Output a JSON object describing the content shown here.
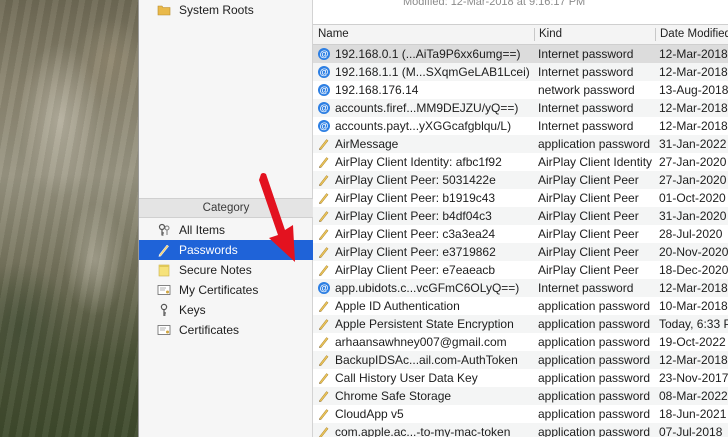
{
  "sidebar": {
    "system_roots": "System Roots",
    "category_header": "Category",
    "categories": [
      {
        "label": "All Items",
        "icon": "keys-icon"
      },
      {
        "label": "Passwords",
        "icon": "pen-icon"
      },
      {
        "label": "Secure Notes",
        "icon": "note-icon"
      },
      {
        "label": "My Certificates",
        "icon": "certificate-icon"
      },
      {
        "label": "Keys",
        "icon": "key-icon"
      },
      {
        "label": "Certificates",
        "icon": "certificate-icon"
      }
    ],
    "selected": "Passwords"
  },
  "main": {
    "modified_text": "Modified:  12-Mar-2018 at 9:16:17 PM",
    "columns": {
      "name": "Name",
      "kind": "Kind",
      "date": "Date Modified"
    },
    "rows": [
      {
        "name": "192.168.0.1 (...AiTa9P6xx6umg==)",
        "kind": "Internet password",
        "date": "12-Mar-2018",
        "icon": "globe"
      },
      {
        "name": "192.168.1.1 (M...SXqmGeLAB1Lcei)",
        "kind": "Internet password",
        "date": "12-Mar-2018",
        "icon": "globe"
      },
      {
        "name": "192.168.176.14",
        "kind": "network password",
        "date": "13-Aug-2018",
        "icon": "globe"
      },
      {
        "name": "accounts.firef...MM9DEJZU/yQ==)",
        "kind": "Internet password",
        "date": "12-Mar-2018",
        "icon": "globe"
      },
      {
        "name": "accounts.payt...yXGGcafgblqu/L)",
        "kind": "Internet password",
        "date": "12-Mar-2018",
        "icon": "globe"
      },
      {
        "name": "AirMessage",
        "kind": "application password",
        "date": "31-Jan-2022",
        "icon": "pen"
      },
      {
        "name": "AirPlay Client Identity: afbc1f92",
        "kind": "AirPlay Client Identity",
        "date": "27-Jan-2020",
        "icon": "pen"
      },
      {
        "name": "AirPlay Client Peer: 5031422e",
        "kind": "AirPlay Client Peer",
        "date": "27-Jan-2020",
        "icon": "pen"
      },
      {
        "name": "AirPlay Client Peer: b1919c43",
        "kind": "AirPlay Client Peer",
        "date": "01-Oct-2020",
        "icon": "pen"
      },
      {
        "name": "AirPlay Client Peer: b4df04c3",
        "kind": "AirPlay Client Peer",
        "date": "31-Jan-2020",
        "icon": "pen"
      },
      {
        "name": "AirPlay Client Peer: c3a3ea24",
        "kind": "AirPlay Client Peer",
        "date": "28-Jul-2020",
        "icon": "pen"
      },
      {
        "name": "AirPlay Client Peer: e3719862",
        "kind": "AirPlay Client Peer",
        "date": "20-Nov-2020",
        "icon": "pen"
      },
      {
        "name": "AirPlay Client Peer: e7eaeacb",
        "kind": "AirPlay Client Peer",
        "date": "18-Dec-2020",
        "icon": "pen"
      },
      {
        "name": "app.ubidots.c...vcGFmC6OLyQ==)",
        "kind": "Internet password",
        "date": "12-Mar-2018",
        "icon": "globe"
      },
      {
        "name": "Apple ID Authentication",
        "kind": "application password",
        "date": "10-Mar-2018",
        "icon": "pen"
      },
      {
        "name": "Apple Persistent State Encryption",
        "kind": "application password",
        "date": "Today, 6:33 P",
        "icon": "pen"
      },
      {
        "name": "arhaansawhney007@gmail.com",
        "kind": "application password",
        "date": "19-Oct-2022",
        "icon": "pen"
      },
      {
        "name": "BackupIDSAc...ail.com-AuthToken",
        "kind": "application password",
        "date": "12-Mar-2018",
        "icon": "pen"
      },
      {
        "name": "Call History User Data Key",
        "kind": "application password",
        "date": "23-Nov-2017",
        "icon": "pen"
      },
      {
        "name": "Chrome Safe Storage",
        "kind": "application password",
        "date": "08-Mar-2022",
        "icon": "pen"
      },
      {
        "name": "CloudApp v5",
        "kind": "application password",
        "date": "18-Jun-2021",
        "icon": "pen"
      },
      {
        "name": "com.apple.ac...-to-my-mac-token",
        "kind": "application password",
        "date": "07-Jul-2018",
        "icon": "pen"
      }
    ],
    "selected_row": 0
  },
  "colors": {
    "selection": "#1f63d8",
    "arrow": "#e3121f",
    "globe": "#2d7fe3"
  }
}
